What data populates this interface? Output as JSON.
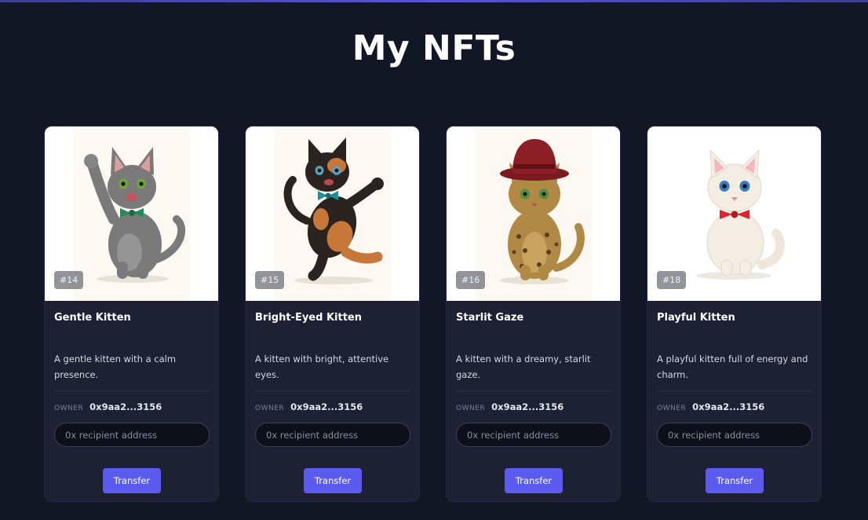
{
  "page": {
    "title": "My NFTs"
  },
  "owner_label": "OWNER",
  "input_placeholder": "0x recipient address",
  "transfer_label": "Transfer",
  "cards": [
    {
      "token": "#14",
      "name": "Gentle Kitten",
      "description": "A gentle kitten with a calm presence.",
      "owner": "0x9aa2...3156",
      "fur": "#7a7a7a",
      "accent": "#1f8a5a",
      "eyes": "#6fa53a"
    },
    {
      "token": "#15",
      "name": "Bright-Eyed Kitten",
      "description": "A kitten with bright, attentive eyes.",
      "owner": "0x9aa2...3156",
      "fur": "#2b2320",
      "accent": "#1d8f9a",
      "eyes": "#5aa0b8"
    },
    {
      "token": "#16",
      "name": "Starlit Gaze",
      "description": "A kitten with a dreamy, starlit gaze.",
      "owner": "0x9aa2...3156",
      "fur": "#b08a45",
      "accent": "#8b1f25",
      "eyes": "#4e8f3c"
    },
    {
      "token": "#18",
      "name": "Playful Kitten",
      "description": "A playful kitten full of energy and charm.",
      "owner": "0x9aa2...3156",
      "fur": "#f3ede4",
      "accent": "#d8262a",
      "eyes": "#3a7cc0"
    }
  ]
}
